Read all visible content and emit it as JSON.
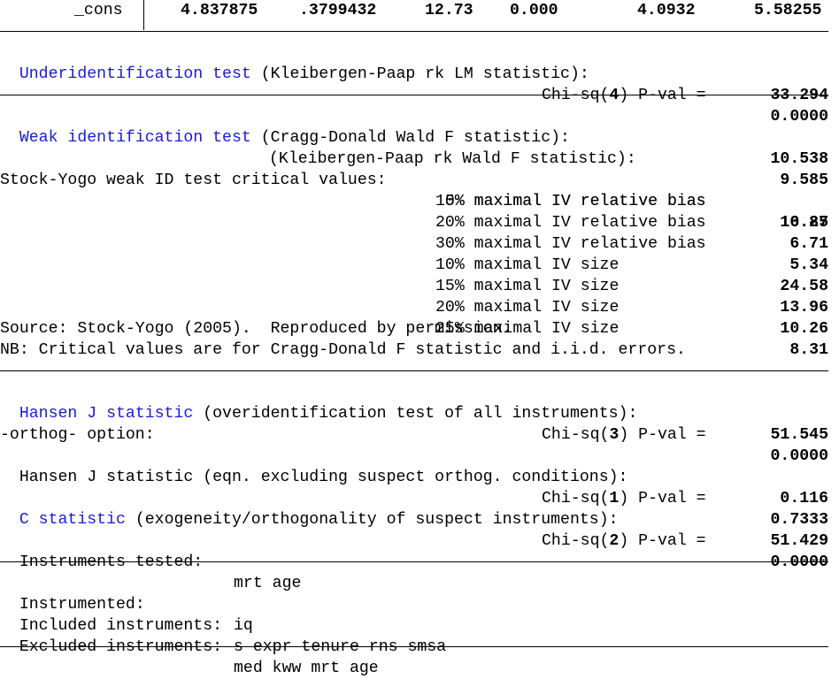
{
  "cons_row": {
    "label": "_cons",
    "coef": "4.837875",
    "se": ".3799432",
    "z": "12.73",
    "p": "0.000",
    "ci_low": "4.0932",
    "ci_high": "5.58255"
  },
  "underid": {
    "title": "Underidentification test",
    "desc": " (Kleibergen-Paap rk LM statistic):",
    "stat": "33.294",
    "chi_pre": "Chi-sq(",
    "chi_df": "4",
    "chi_post": ") P-val =",
    "pval": "0.0000"
  },
  "weakid": {
    "title": "Weak identification test",
    "desc1": " (Cragg-Donald Wald F statistic):",
    "stat1": "10.538",
    "desc2": "(Kleibergen-Paap rk Wald F statistic):",
    "stat2": "9.585",
    "sy_label": "Stock-Yogo weak ID test critical values:",
    "critical_values": [
      {
        "label": " 5% maximal IV relative bias",
        "value": "16.85"
      },
      {
        "label": "10% maximal IV relative bias",
        "value": "10.27"
      },
      {
        "label": "20% maximal IV relative bias",
        "value": "6.71"
      },
      {
        "label": "30% maximal IV relative bias",
        "value": "5.34"
      },
      {
        "label": "10% maximal IV size",
        "value": "24.58"
      },
      {
        "label": "15% maximal IV size",
        "value": "13.96"
      },
      {
        "label": "20% maximal IV size",
        "value": "10.26"
      },
      {
        "label": "25% maximal IV size",
        "value": "8.31"
      }
    ],
    "source": "Source: Stock-Yogo (2005).  Reproduced by permission.",
    "nb": "NB: Critical values are for Cragg-Donald F statistic and i.i.d. errors."
  },
  "hansen": {
    "title": "Hansen J statistic",
    "desc": " (overidentification test of all instruments):",
    "stat": "51.545",
    "chi_pre": "Chi-sq(",
    "chi_df": "3",
    "chi_post": ") P-val =",
    "pval": "0.0000"
  },
  "orthog": {
    "option": "-orthog- option:",
    "hansen2_desc": "Hansen J statistic (eqn. excluding suspect orthog. conditions):",
    "hansen2_stat": "0.116",
    "chi1_pre": "Chi-sq(",
    "chi1_df": "1",
    "chi1_post": ") P-val =",
    "chi1_pval": "0.7333",
    "c_title": "C statistic",
    "c_desc": " (exogeneity/orthogonality of suspect instruments):",
    "c_stat": "51.429",
    "chi2_pre": "Chi-sq(",
    "chi2_df": "2",
    "chi2_post": ") P-val =",
    "chi2_pval": "0.0000",
    "tested_label": "Instruments tested:",
    "tested_value": "mrt age"
  },
  "instruments": {
    "instrumented_label": "Instrumented:",
    "instrumented_value": "iq",
    "included_label": "Included instruments:",
    "included_value": "s expr tenure rns smsa",
    "excluded_label": "Excluded instruments:",
    "excluded_value": "med kww mrt age"
  }
}
